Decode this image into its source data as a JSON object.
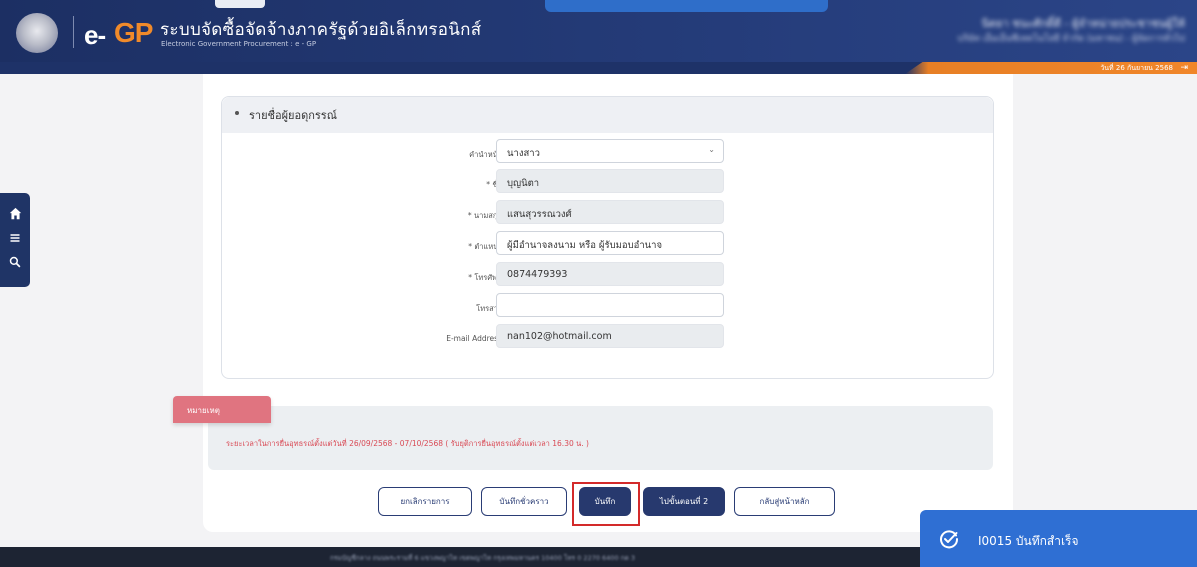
{
  "header": {
    "title": "ระบบจัดซื้อจัดจ้างภาครัฐด้วยอิเล็กทรอนิกส์",
    "subtitle": "Electronic Government Procurement : e - GP",
    "logo_e": "e-",
    "logo_gp": "GP",
    "user_name": "นิตยา ชนะศักดิ์ดี - ผู้จำหน่ายประชาชนผู้ให้",
    "user_org": "บริษัท เอ็มเอ็นซีเทคโนโลยี จำกัด (มหาชน) - ผู้จัดการทั่วไป",
    "date": "วันที่ 26 กันยายน 2568"
  },
  "section": {
    "title": "รายชื่อผู้ยอดุกรรณ์"
  },
  "form": {
    "prefix": {
      "label": "คำนำหน้า",
      "value": "นางสาว"
    },
    "first_name": {
      "label": "* ชื่อ",
      "value": "บุญนิตา"
    },
    "last_name": {
      "label": "* นามสกุล",
      "value": "แสนสุวรรณวงศ์"
    },
    "position": {
      "label": "* ตำแหน่ง",
      "value": "ผู้มีอำนาจลงนาม หรือ ผู้รับมอบอำนาจ"
    },
    "phone": {
      "label": "* โทรศัพท์",
      "value": "0874479393"
    },
    "fax": {
      "label": "โทรสาร",
      "value": ""
    },
    "email": {
      "label": "E-mail Address",
      "value": "nan102@hotmail.com"
    }
  },
  "note": {
    "tag": "หมายเหตุ",
    "text": "ระยะเวลาในการยื่นอุทธรณ์ตั้งแต่วันที่ 26/09/2568 - 07/10/2568 ( รับยุติการยื่นอุทธรณ์ตั้งแต่เวลา 16.30 น. )"
  },
  "buttons": {
    "cancel": "ยกเลิกรายการ",
    "draft": "บันทึกชั่วคราว",
    "save": "บันทึก",
    "next": "ไปขั้นตอนที่ 2",
    "home": "กลับสู่หน้าหลัก"
  },
  "toast": {
    "text": "I0015 บันทึกสำเร็จ"
  },
  "footer": {
    "text": "กรมบัญชีกลาง ถนนพระรามที่ 6 แขวงพญาไท เขตพญาไท กรุงเทพมหานคร 10400 โทร 0 2270 6400 กด 3"
  },
  "colors": {
    "header_bg": "#1c2f63",
    "accent_orange": "#f08a2a",
    "primary_button": "#27396e",
    "note_tag": "#e07480",
    "note_text": "#d94a55",
    "toast_bg": "#2f6fd3",
    "highlight_border": "#d32a2a"
  },
  "icons": {
    "home": "home-icon",
    "menu": "menu-icon",
    "search": "search-icon",
    "exit": "exit-icon",
    "toast": "check-circle-icon",
    "select": "chevron-down-icon"
  }
}
